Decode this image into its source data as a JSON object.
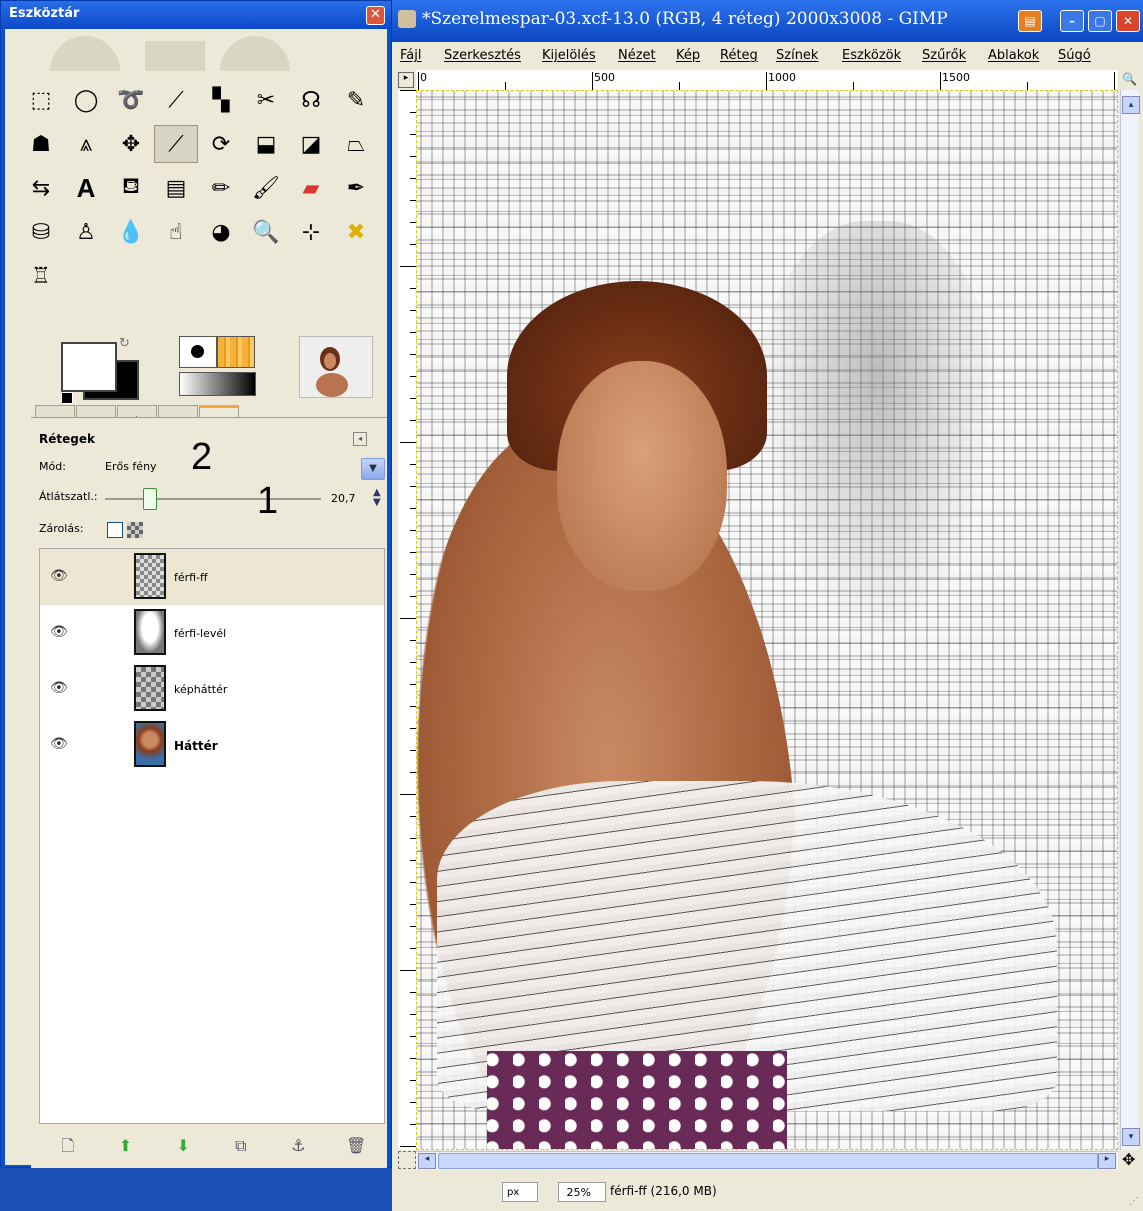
{
  "toolbox": {
    "title": "Eszköztár",
    "close_glyph": "✕",
    "tools": [
      [
        "rect-select-icon",
        "ellipse-select-icon",
        "free-select-icon",
        "fuzzy-select-icon",
        "color-select-icon",
        "scissors-icon",
        "foreground-select-icon",
        "paths-icon"
      ],
      [
        "color-picker-icon",
        "measure-icon",
        "move-icon",
        "align-icon",
        "crop-icon",
        "rotate-icon",
        "scale-icon",
        "shear-icon"
      ],
      [
        "flip-icon",
        "text-icon",
        "bucket-fill-icon",
        "blend-icon",
        "pencil-icon",
        "paintbrush-icon",
        "eraser-icon",
        "airbrush-icon"
      ],
      [
        "ink-icon",
        "clone-icon",
        "blur-icon",
        "smudge-icon",
        "dodge-icon",
        "magnify-icon",
        "cage-icon",
        "heal-icon"
      ],
      [
        "perspective-clone-icon"
      ]
    ],
    "active_tool": "align-icon"
  },
  "dock_tabs": [
    "tool-options-tab",
    "undo-history-tab",
    "paths-tab",
    "channels-tab",
    "layers-tab"
  ],
  "layers": {
    "title": "Rétegek",
    "mode_label": "Mód:",
    "mode_value": "Erős fény",
    "opacity_label": "Átlátszatl.:",
    "opacity_value": "20,7",
    "opacity_fraction": 0.207,
    "lock_label": "Zárolás:",
    "annotation_1": "1",
    "annotation_2": "2",
    "items": [
      {
        "name": "férfi-ff",
        "visible": true,
        "selected": true,
        "bold": false
      },
      {
        "name": "férfi-levél",
        "visible": true,
        "selected": false,
        "bold": false
      },
      {
        "name": "képháttér",
        "visible": true,
        "selected": false,
        "bold": false
      },
      {
        "name": "Háttér",
        "visible": true,
        "selected": false,
        "bold": true
      }
    ],
    "buttons": [
      "new-layer-icon",
      "raise-layer-icon",
      "lower-layer-icon",
      "duplicate-layer-icon",
      "anchor-layer-icon",
      "delete-layer-icon"
    ]
  },
  "image_window": {
    "title": "*Szerelmespar-03.xcf-13.0 (RGB, 4 réteg) 2000x3008 - GIMP",
    "menu": [
      "Fájl",
      "Szerkesztés",
      "Kijelölés",
      "Nézet",
      "Kép",
      "Réteg",
      "Színek",
      "Eszközök",
      "Szűrők",
      "Ablakok",
      "Súgó"
    ],
    "ruler_labels": [
      "0",
      "500",
      "1000",
      "1500"
    ],
    "unit": "px",
    "zoom": "25%",
    "status": "férfi-ff (216,0 MB)",
    "scroll_down_glyph": "▾",
    "scroll_up_glyph": "▴"
  }
}
